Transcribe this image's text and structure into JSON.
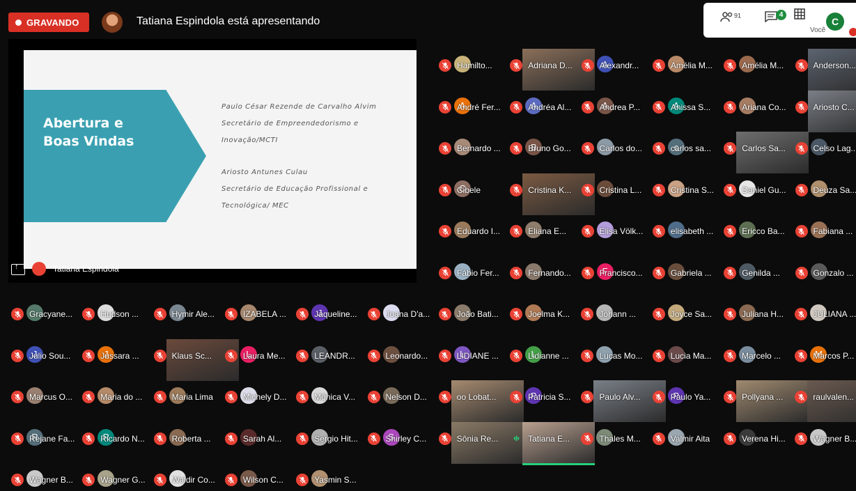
{
  "header": {
    "recording_label": "GRAVANDO",
    "presenting_text": "Tatiana Espindola está apresentando",
    "people_count": "91",
    "chat_badge": "4",
    "you_initial": "C",
    "you_label": "Você"
  },
  "presentation": {
    "slide_title": "Abertura e Boas Vindas",
    "lines": [
      "Paulo César Rezende de Carvalho Alvim",
      "Secretário de Empreendedorismo e",
      "Inovação/MCTI",
      "Ariosto Antunes Culau",
      "Secretário de Educação Profissional e",
      "Tecnológica/ MEC"
    ],
    "presenter_name": "Tatiana Espindola"
  },
  "participants": [
    {
      "name": "Hamilto...",
      "type": "photo",
      "color": "#c9b37a"
    },
    {
      "name": "Adriana D...",
      "type": "video",
      "color": "#8a6f5a"
    },
    {
      "name": "Alexandr...",
      "type": "initial",
      "initial": "A",
      "color": "#3f51b5"
    },
    {
      "name": "Amélia M...",
      "type": "photo",
      "color": "#b98a68"
    },
    {
      "name": "Amélia M...",
      "type": "photo",
      "color": "#9b6a4e"
    },
    {
      "name": "Anderson...",
      "type": "video",
      "color": "#5c6470"
    },
    {
      "name": "André Fer...",
      "type": "initial",
      "initial": "A",
      "color": "#e8710a"
    },
    {
      "name": "Andréa Al...",
      "type": "initial",
      "initial": "A",
      "color": "#5c6bc0"
    },
    {
      "name": "Andrea P...",
      "type": "initial",
      "initial": "A",
      "color": "#795548"
    },
    {
      "name": "Anissa S...",
      "type": "initial",
      "initial": "A",
      "color": "#00897b"
    },
    {
      "name": "Ariana Co...",
      "type": "photo",
      "color": "#a67c63"
    },
    {
      "name": "Ariosto C...",
      "type": "video",
      "color": "#7a7f86"
    },
    {
      "name": "Bernardo ...",
      "type": "photo",
      "color": "#a88a78"
    },
    {
      "name": "Bruno Go...",
      "type": "initial",
      "initial": "B",
      "color": "#795548"
    },
    {
      "name": "Carlos do...",
      "type": "photo",
      "color": "#8c9aa6"
    },
    {
      "name": "carlos sa...",
      "type": "initial",
      "initial": "c",
      "color": "#546e7a"
    },
    {
      "name": "Carlos Sa...",
      "type": "video",
      "color": "#6e6e6e"
    },
    {
      "name": "Celso Lag...",
      "type": "photo",
      "color": "#4a5766"
    },
    {
      "name": "Cibele",
      "type": "initial",
      "initial": "C",
      "color": "#8d6e63"
    },
    {
      "name": "Cristina K...",
      "type": "video",
      "color": "#7b5a42"
    },
    {
      "name": "Cristina L...",
      "type": "photo",
      "color": "#6b4b3a"
    },
    {
      "name": "Cristina S...",
      "type": "photo",
      "color": "#caa184"
    },
    {
      "name": "Daniel Gu...",
      "type": "photo",
      "color": "#e6e6e6"
    },
    {
      "name": "Deuza Sa...",
      "type": "photo",
      "color": "#b08f6d"
    },
    {
      "name": "Eduardo I...",
      "type": "photo",
      "color": "#9a7a5c"
    },
    {
      "name": "Eliana E...",
      "type": "photo",
      "color": "#8f7d6b"
    },
    {
      "name": "Elisa Völk...",
      "type": "photo",
      "color": "#b39ddb"
    },
    {
      "name": "elisabeth ...",
      "type": "photo",
      "color": "#4f6d8a"
    },
    {
      "name": "Ericco Ba...",
      "type": "photo",
      "color": "#5d6f52"
    },
    {
      "name": "Fabiana ...",
      "type": "photo",
      "color": "#9a7054"
    },
    {
      "name": "Fábio Fer...",
      "type": "photo",
      "color": "#9ab0c2"
    },
    {
      "name": "Fernando...",
      "type": "photo",
      "color": "#8a7a6c"
    },
    {
      "name": "Francisco...",
      "type": "initial",
      "initial": "F",
      "color": "#e91e63"
    },
    {
      "name": "Gabriela ...",
      "type": "photo",
      "color": "#6a4e3c"
    },
    {
      "name": "Genilda ...",
      "type": "photo",
      "color": "#4e5a63"
    },
    {
      "name": "Gonzalo ...",
      "type": "photo",
      "color": "#5a5a5a"
    },
    {
      "name": "Gracyane...",
      "type": "photo",
      "color": "#557a6a"
    },
    {
      "name": "Hudson ...",
      "type": "photo",
      "color": "#ddd"
    },
    {
      "name": "Hymir Ale...",
      "type": "photo",
      "color": "#7a8690"
    },
    {
      "name": "IZABELA ...",
      "type": "photo",
      "color": "#a7876d"
    },
    {
      "name": "Jaqueline...",
      "type": "initial",
      "initial": "J",
      "color": "#5e35b1"
    },
    {
      "name": "Joana D'a...",
      "type": "photo",
      "color": "#dcdcf0"
    },
    {
      "name": "João Bati...",
      "type": "photo",
      "color": "#8b7b6a"
    },
    {
      "name": "Joelma K...",
      "type": "photo",
      "color": "#b07a55"
    },
    {
      "name": "Johann ...",
      "type": "photo",
      "color": "#b5b5b5"
    },
    {
      "name": "Joyce Sa...",
      "type": "photo",
      "color": "#c4a97b"
    },
    {
      "name": "Juliana H...",
      "type": "photo",
      "color": "#8a6a52"
    },
    {
      "name": "JULIANA ...",
      "type": "photo",
      "color": "#d0c8c0"
    },
    {
      "name": "Julio Sou...",
      "type": "initial",
      "initial": "J",
      "color": "#3f51b5"
    },
    {
      "name": "Jussara ...",
      "type": "initial",
      "initial": "J",
      "color": "#e8710a"
    },
    {
      "name": "Klaus Sc...",
      "type": "video",
      "color": "#6b4a3c"
    },
    {
      "name": "Laura Me...",
      "type": "initial",
      "initial": "L",
      "color": "#e91e63"
    },
    {
      "name": "LEANDR...",
      "type": "photo",
      "color": "#5a5f66"
    },
    {
      "name": "Leonardo...",
      "type": "photo",
      "color": "#6e5040"
    },
    {
      "name": "LIDIANE ...",
      "type": "initial",
      "initial": "L",
      "color": "#7e57c2"
    },
    {
      "name": "Lidianne ...",
      "type": "initial",
      "initial": "L",
      "color": "#43a047"
    },
    {
      "name": "Lucas Mo...",
      "type": "photo",
      "color": "#8ea1ad"
    },
    {
      "name": "Lucia Ma...",
      "type": "photo",
      "color": "#6b4a4a"
    },
    {
      "name": "Marcelo ...",
      "type": "photo",
      "color": "#7a8d9e"
    },
    {
      "name": "Marcos P...",
      "type": "initial",
      "initial": "M",
      "color": "#e8710a"
    },
    {
      "name": "Marcus O...",
      "type": "photo",
      "color": "#9a8070"
    },
    {
      "name": "Maria do ...",
      "type": "photo",
      "color": "#b58a68"
    },
    {
      "name": "Maria Lima",
      "type": "photo",
      "color": "#9c7a5a"
    },
    {
      "name": "Michely D...",
      "type": "photo",
      "color": "#dcdce8"
    },
    {
      "name": "Mônica V...",
      "type": "photo",
      "color": "#d8d8d8"
    },
    {
      "name": "Nelson D...",
      "type": "photo",
      "color": "#7a6a5a"
    },
    {
      "name": "oo Lobat...",
      "type": "video",
      "color": "#a58a70"
    },
    {
      "name": "Patricia S...",
      "type": "initial",
      "initial": "P",
      "color": "#5e35b1"
    },
    {
      "name": "Paulo Alv...",
      "type": "video",
      "color": "#7a8088"
    },
    {
      "name": "Paulo Ya...",
      "type": "initial",
      "initial": "P",
      "color": "#5e35b1"
    },
    {
      "name": "Pollyana ...",
      "type": "video",
      "color": "#a08a70"
    },
    {
      "name": "raulvalen...",
      "type": "video",
      "color": "#6a5a50"
    },
    {
      "name": "Rejane Fa...",
      "type": "initial",
      "initial": "R",
      "color": "#546e7a"
    },
    {
      "name": "Ricardo N...",
      "type": "initial",
      "initial": "R",
      "color": "#00897b"
    },
    {
      "name": "Roberta ...",
      "type": "photo",
      "color": "#8a6a52"
    },
    {
      "name": "Sarah Al...",
      "type": "photo",
      "color": "#5a2a2a"
    },
    {
      "name": "Sergio Hit...",
      "type": "photo",
      "color": "#b0b0b0"
    },
    {
      "name": "Shirley C...",
      "type": "initial",
      "initial": "S",
      "color": "#ab47bc"
    },
    {
      "name": "Sônia Re...",
      "type": "video",
      "color": "#8a7a66"
    },
    {
      "name": "Tatiana E...",
      "type": "video-speaking",
      "color": "#b8a090"
    },
    {
      "name": "Thales M...",
      "type": "photo",
      "color": "#7d8a78"
    },
    {
      "name": "Valmir Aita",
      "type": "photo",
      "color": "#9aa6b0"
    },
    {
      "name": "Verena Hi...",
      "type": "photo",
      "color": "#3a3a3a"
    },
    {
      "name": "Wagner B...",
      "type": "photo",
      "color": "#c8c8c8"
    },
    {
      "name": "Wagner B...",
      "type": "photo",
      "color": "#c9c9c9"
    },
    {
      "name": "Wagner G...",
      "type": "photo",
      "color": "#a8a28a"
    },
    {
      "name": "Waldir Co...",
      "type": "photo",
      "color": "#e0e0e0"
    },
    {
      "name": "Wilson C...",
      "type": "photo",
      "color": "#7a5a4a"
    },
    {
      "name": "Yasmin S...",
      "type": "photo",
      "color": "#b09070"
    }
  ],
  "colors": {
    "muted": "#e94235",
    "recording": "#d93025",
    "speaking": "#26d07c"
  }
}
